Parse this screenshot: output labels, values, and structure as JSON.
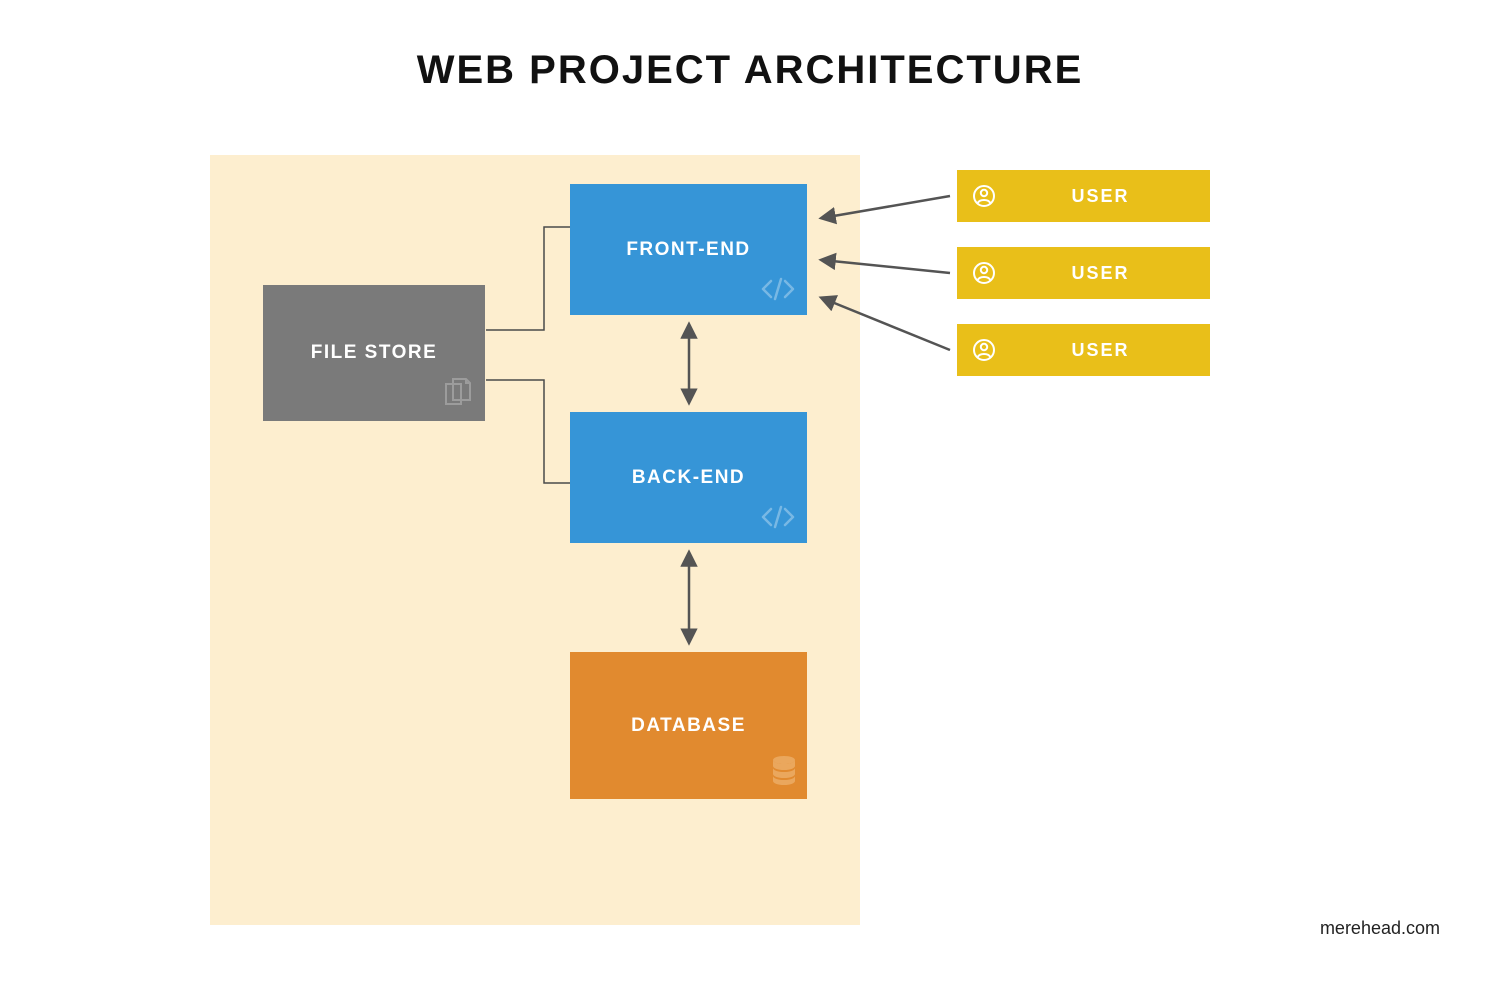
{
  "title": "WEB PROJECT ARCHITECTURE",
  "attribution": "merehead.com",
  "panel_bg": "#fdeecf",
  "colors": {
    "file_store": "#7a7a7a",
    "front_end": "#3695d7",
    "back_end": "#3695d7",
    "database": "#e18a2f",
    "user": "#e9bf19",
    "arrow": "#545454"
  },
  "boxes": {
    "file_store": {
      "label": "FILE STORE",
      "icon": "documents-icon"
    },
    "front_end": {
      "label": "FRONT-END",
      "icon": "code-icon"
    },
    "back_end": {
      "label": "BACK-END",
      "icon": "code-icon"
    },
    "database": {
      "label": "DATABASE",
      "icon": "database-icon"
    }
  },
  "users": [
    {
      "label": "USER",
      "icon": "user-icon"
    },
    {
      "label": "USER",
      "icon": "user-icon"
    },
    {
      "label": "USER",
      "icon": "user-icon"
    }
  ],
  "connections": [
    {
      "from": "front_end",
      "to": "back_end",
      "type": "bidirectional"
    },
    {
      "from": "back_end",
      "to": "database",
      "type": "bidirectional"
    },
    {
      "from": "file_store",
      "to": "front_end",
      "type": "line"
    },
    {
      "from": "file_store",
      "to": "back_end",
      "type": "line"
    },
    {
      "from": "user1",
      "to": "front_end",
      "type": "arrow"
    },
    {
      "from": "user2",
      "to": "front_end",
      "type": "arrow"
    },
    {
      "from": "user3",
      "to": "front_end",
      "type": "arrow"
    }
  ]
}
